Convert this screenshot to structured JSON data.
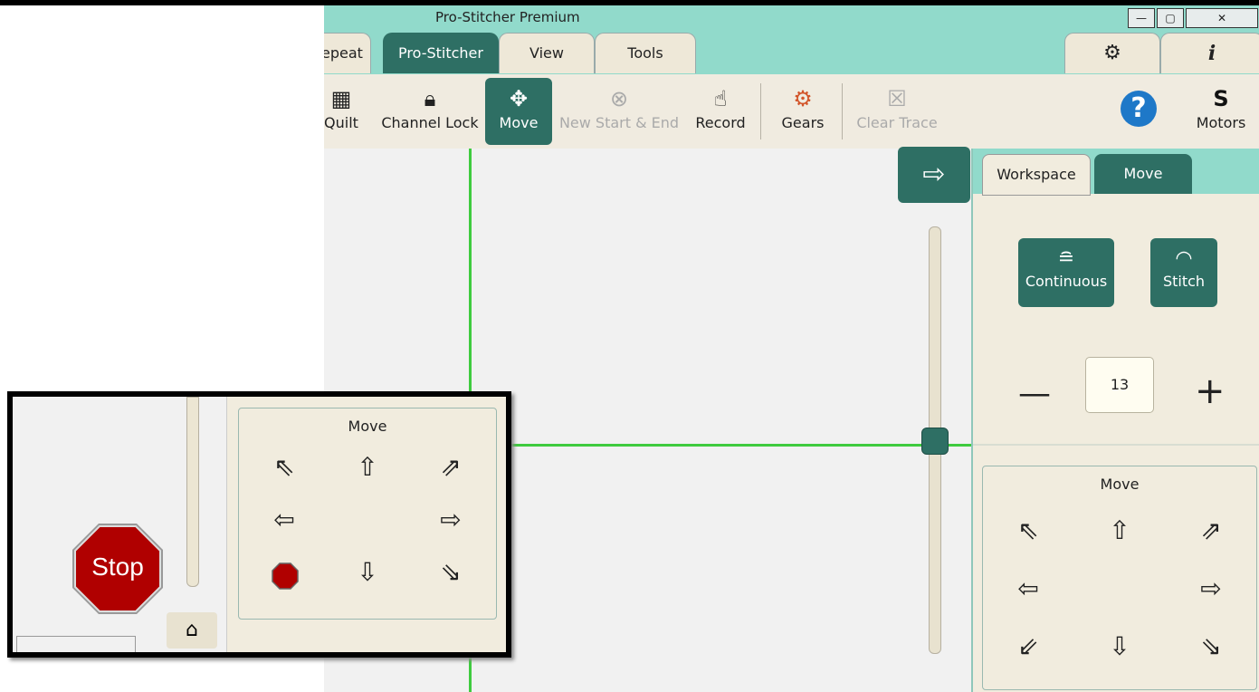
{
  "window": {
    "title": "Pro-Stitcher Premium",
    "controls": [
      "—",
      "▢",
      "✕"
    ]
  },
  "tabs": [
    {
      "label": "epeat"
    },
    {
      "label": "Pro-Stitcher"
    },
    {
      "label": "View"
    },
    {
      "label": "Tools"
    }
  ],
  "right_tabs": {
    "settings_icon": "gear-icon",
    "info_icon": "info-icon",
    "settings_glyph": "⚙",
    "info_glyph": "i"
  },
  "ribbon": {
    "quilt": "Quilt",
    "channel_lock": "Channel Lock",
    "move": "Move",
    "new_start_end": "New Start & End",
    "record": "Record",
    "gears": "Gears",
    "clear_trace": "Clear Trace",
    "help_glyph": "?",
    "motors": "Motors",
    "motors_glyph": "S"
  },
  "canvas": {
    "arrow_glyph": "⇨"
  },
  "panel": {
    "tabs": {
      "workspace": "Workspace",
      "move": "Move"
    },
    "continuous": "Continuous",
    "stitch": "Stitch",
    "minus": "—",
    "plus": "+",
    "speed_value": "13",
    "move_title": "Move",
    "arrows": {
      "up_left": "⇖",
      "up": "⇧",
      "up_right": "⇗",
      "left": "⇦",
      "right": "⇨",
      "down_left": "⇙",
      "down": "⇩",
      "down_right": "⇘"
    }
  },
  "inset": {
    "move_title": "Move",
    "stop_label": "Stop",
    "home_glyph": "⌂",
    "arrows": {
      "up_left": "⇖",
      "up": "⇧",
      "up_right": "⇗",
      "left": "⇦",
      "right": "⇨",
      "down": "⇩",
      "down_right": "⇘"
    }
  },
  "colors": {
    "accent": "#2e6f64",
    "titlebar": "#91dacb",
    "guide_line": "#3fcb3f",
    "stop_red": "#b00000"
  }
}
